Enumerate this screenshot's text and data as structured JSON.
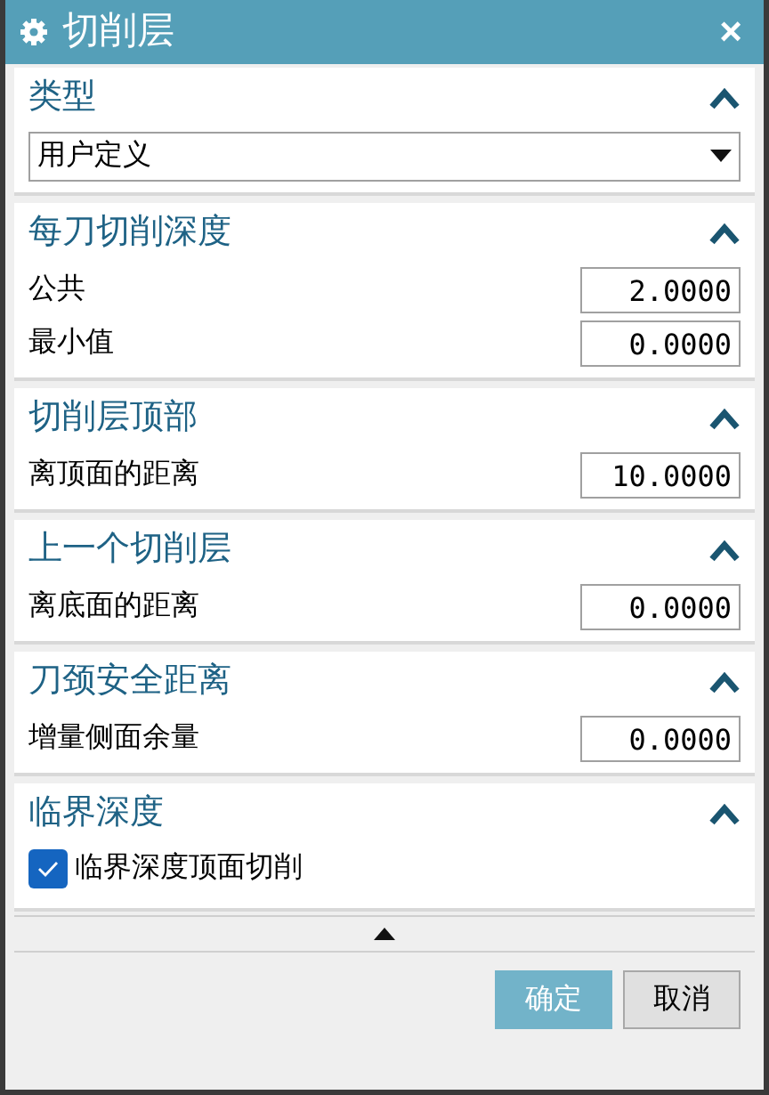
{
  "window": {
    "title": "切削层",
    "close": "×"
  },
  "sections": [
    {
      "title": "类型",
      "expanded": true,
      "rows": [
        {
          "kind": "dropdown",
          "value": "用户定义"
        }
      ]
    },
    {
      "title": "每刀切削深度",
      "expanded": true,
      "rows": [
        {
          "kind": "number",
          "label": "公共",
          "value": "2.0000"
        },
        {
          "kind": "number",
          "label": "最小值",
          "value": "0.0000"
        }
      ]
    },
    {
      "title": "切削层顶部",
      "expanded": true,
      "rows": [
        {
          "kind": "number",
          "label": "离顶面的距离",
          "value": "10.0000"
        }
      ]
    },
    {
      "title": "上一个切削层",
      "expanded": true,
      "rows": [
        {
          "kind": "number",
          "label": "离底面的距离",
          "value": "0.0000"
        }
      ]
    },
    {
      "title": "刀颈安全距离",
      "expanded": true,
      "rows": [
        {
          "kind": "number",
          "label": "增量侧面余量",
          "value": "0.0000"
        }
      ]
    },
    {
      "title": "临界深度",
      "expanded": true,
      "rows": [
        {
          "kind": "checkbox",
          "label": "临界深度顶面切削",
          "checked": true
        }
      ]
    }
  ],
  "buttons": [
    {
      "label": "确定",
      "kind": "primary"
    },
    {
      "label": "取消",
      "kind": "secondary"
    }
  ]
}
